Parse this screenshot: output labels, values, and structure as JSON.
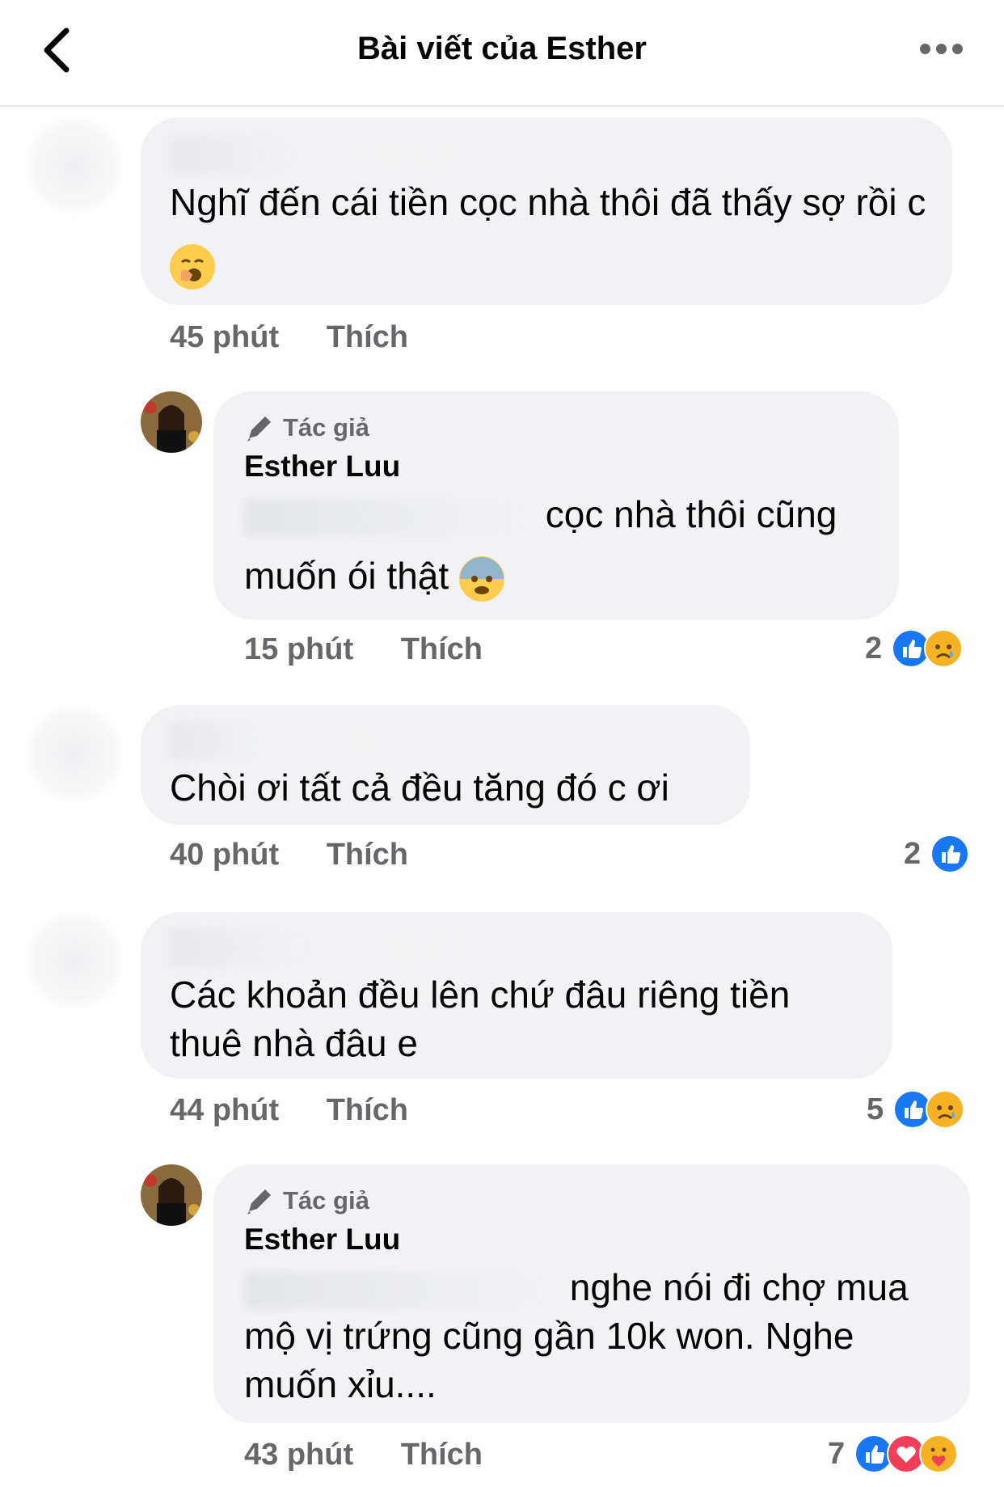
{
  "header": {
    "title": "Bài viết của Esther"
  },
  "comments": [
    {
      "text": "Nghĩ đến cái tiền cọc nhà thôi đã thấy sợ rồi c",
      "time": "45 phút",
      "like": "Thích"
    },
    {
      "badge": "Tác giả",
      "author": "Esther Luu",
      "text_line1": "cọc nhà thôi cũng",
      "text_line2": "muốn ói thật",
      "time": "15 phút",
      "like": "Thích",
      "reaction_count": "2"
    },
    {
      "text": "Chòi ơi tất cả đều tăng đó c ơi",
      "time": "40 phút",
      "like": "Thích",
      "reaction_count": "2"
    },
    {
      "text_line1": "Các khoản đều lên chứ đâu riêng tiền",
      "text_line2": "thuê nhà đâu e",
      "time": "44 phút",
      "like": "Thích",
      "reaction_count": "5"
    },
    {
      "badge": "Tác giả",
      "author": "Esther Luu",
      "text_line1": "nghe nói đi chợ mua",
      "text_line2": "mộ vị trứng cũng gần 10k won. Nghe",
      "text_line3": "muốn xỉu....",
      "time": "43 phút",
      "like": "Thích",
      "reaction_count": "7"
    }
  ],
  "colors": {
    "like": "#1877f2",
    "love": "#f33e58",
    "sad": "#f7b125",
    "bubble": "#f0f2f5",
    "meta": "#65676b"
  }
}
